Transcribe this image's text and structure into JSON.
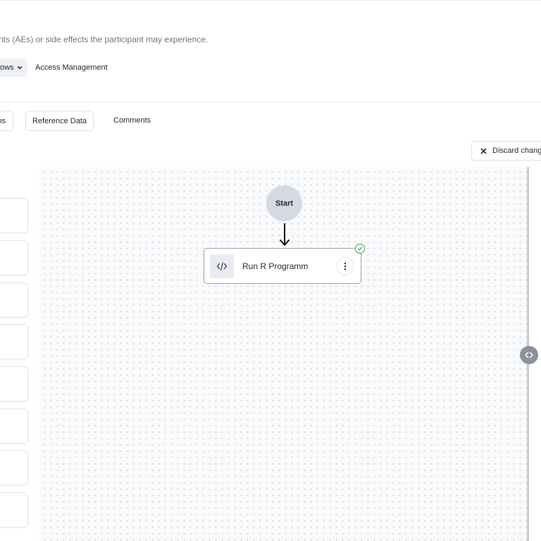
{
  "header": {
    "description": "nts (AEs) or side effects the participant may experience."
  },
  "nav": {
    "workflows_label": "ows",
    "access_management_label": "Access Management"
  },
  "tabs": {
    "first_label": "ns",
    "reference_data_label": "Reference Data",
    "comments_label": "Comments"
  },
  "actions": {
    "discard_label": "Discard change"
  },
  "workflow": {
    "start_label": "Start",
    "steps": [
      {
        "label": "Run R Programm",
        "icon": "code-icon",
        "status": "check-icon"
      }
    ]
  },
  "colors": {
    "status_ok": "#3a9a52",
    "start_node": "#d5dae2",
    "canvas_bg": "#f9fafb"
  }
}
